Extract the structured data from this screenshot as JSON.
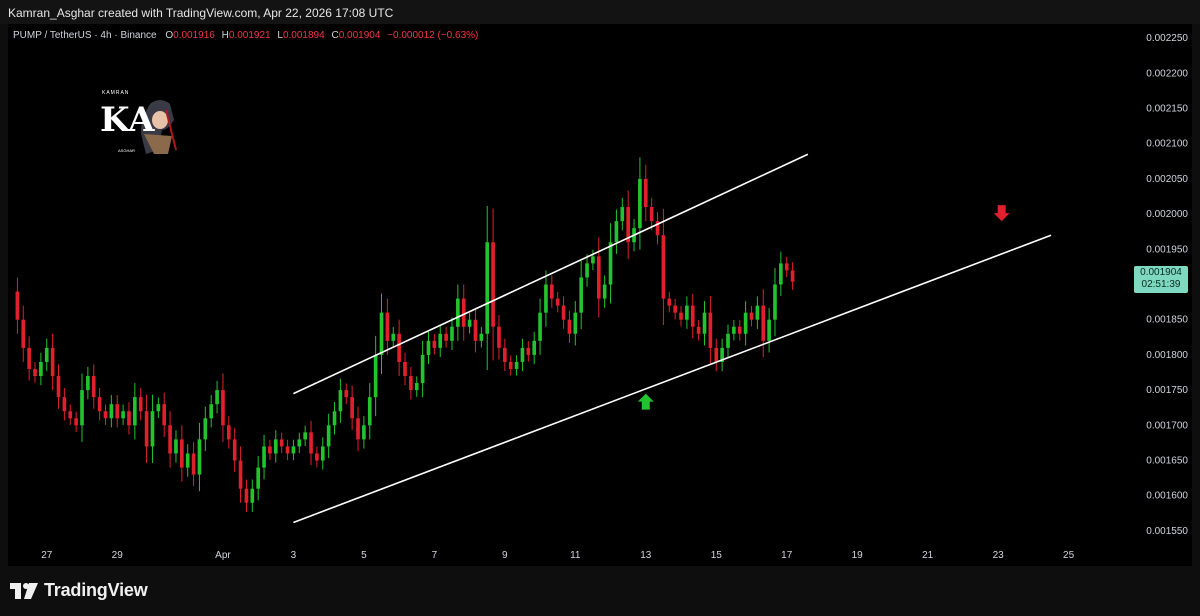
{
  "header": {
    "credit": "Kamran_Asghar created with TradingView.com, Apr 22, 2026 17:08 UTC"
  },
  "legend": {
    "symbol": "PUMP / TetherUS · 4h · Binance",
    "open_label": "O",
    "open": "0.001916",
    "high_label": "H",
    "high": "0.001921",
    "low_label": "L",
    "low": "0.001894",
    "close_label": "C",
    "close": "0.001904",
    "change": "−0.000012 (−0.63%)"
  },
  "price_tag": {
    "price": "0.001904",
    "countdown": "02:51:39"
  },
  "author_badge": {
    "top": "KAMRAN",
    "letters": "KA",
    "bottom": "ASGHAR"
  },
  "footer": {
    "brand": "TradingView"
  },
  "colors": {
    "up": "#22c32e",
    "down": "#e0202c",
    "background": "#000000",
    "trendline": "#ffffff",
    "arrow_up": "#22c32e",
    "arrow_down": "#e0202c",
    "price_tag": "#7fd8c0"
  },
  "chart_data": {
    "type": "candlestick",
    "title": "",
    "ylim": [
      0.00153,
      0.00227
    ],
    "y_ticks": [
      "0.001550",
      "0.001600",
      "0.001650",
      "0.001700",
      "0.001750",
      "0.001800",
      "0.001850",
      "0.001900",
      "0.001950",
      "0.002000",
      "0.002050",
      "0.002100",
      "0.002150",
      "0.002200",
      "0.002250"
    ],
    "x_ticks": [
      "27",
      "29",
      "Apr",
      "3",
      "5",
      "7",
      "9",
      "11",
      "13",
      "15",
      "17",
      "19",
      "21",
      "23",
      "25"
    ],
    "x_tick_days": [
      -5,
      -3,
      0,
      2,
      4,
      6,
      8,
      10,
      12,
      14,
      16,
      18,
      20,
      22,
      24
    ],
    "x_domain_days": [
      -6.1,
      25.6
    ],
    "x_axis_note": "day offset 0 = Apr 1, 2026 00:00; candles are 4h",
    "candles_4h": {
      "start_day": -6.0,
      "closes": [
        0.00189,
        0.00185,
        0.00181,
        0.00178,
        0.00177,
        0.00179,
        0.00181,
        0.00177,
        0.00174,
        0.00172,
        0.00171,
        0.0017,
        0.00175,
        0.00177,
        0.00174,
        0.00172,
        0.00171,
        0.00173,
        0.00171,
        0.00172,
        0.0017,
        0.00174,
        0.00172,
        0.00167,
        0.00172,
        0.00173,
        0.0017,
        0.00166,
        0.00168,
        0.00164,
        0.00166,
        0.00163,
        0.00168,
        0.00171,
        0.00173,
        0.00175,
        0.0017,
        0.00168,
        0.00165,
        0.00161,
        0.00159,
        0.00161,
        0.00164,
        0.00167,
        0.00166,
        0.00168,
        0.00167,
        0.00166,
        0.00167,
        0.00168,
        0.00169,
        0.00166,
        0.00165,
        0.00167,
        0.0017,
        0.00172,
        0.00175,
        0.00174,
        0.00171,
        0.00168,
        0.0017,
        0.00174,
        0.0018,
        0.00186,
        0.00182,
        0.00183,
        0.00179,
        0.00177,
        0.00175,
        0.00176,
        0.0018,
        0.00182,
        0.00181,
        0.00183,
        0.00182,
        0.00184,
        0.00188,
        0.00184,
        0.00185,
        0.00182,
        0.00183,
        0.00196,
        0.00184,
        0.00181,
        0.00179,
        0.00178,
        0.00179,
        0.00181,
        0.0018,
        0.00182,
        0.00186,
        0.0019,
        0.00188,
        0.00187,
        0.00185,
        0.00183,
        0.00186,
        0.00191,
        0.00193,
        0.00194,
        0.00188,
        0.0019,
        0.00196,
        0.00199,
        0.00201,
        0.00196,
        0.00198,
        0.00205,
        0.00201,
        0.00199,
        0.00197,
        0.00188,
        0.00187,
        0.00186,
        0.00185,
        0.00187,
        0.00184,
        0.00183,
        0.00186,
        0.00181,
        0.00179,
        0.00181,
        0.00183,
        0.00184,
        0.00183,
        0.00186,
        0.00185,
        0.00187,
        0.00182,
        0.00185,
        0.0019,
        0.00193,
        0.00192,
        0.001904
      ],
      "shown_candles": 136
    },
    "annotations": [
      {
        "type": "trendline",
        "label": "channel-upper",
        "x_days": [
          2.0,
          16.6
        ],
        "y": [
          0.001745,
          0.002085
        ]
      },
      {
        "type": "trendline",
        "label": "channel-lower",
        "x_days": [
          2.0,
          23.5
        ],
        "y": [
          0.001562,
          0.00197
        ]
      },
      {
        "type": "arrow",
        "direction": "up",
        "x_day": 12.0,
        "y": 0.001745
      },
      {
        "type": "arrow",
        "direction": "down",
        "x_day": 22.1,
        "y": 0.00199
      }
    ]
  }
}
